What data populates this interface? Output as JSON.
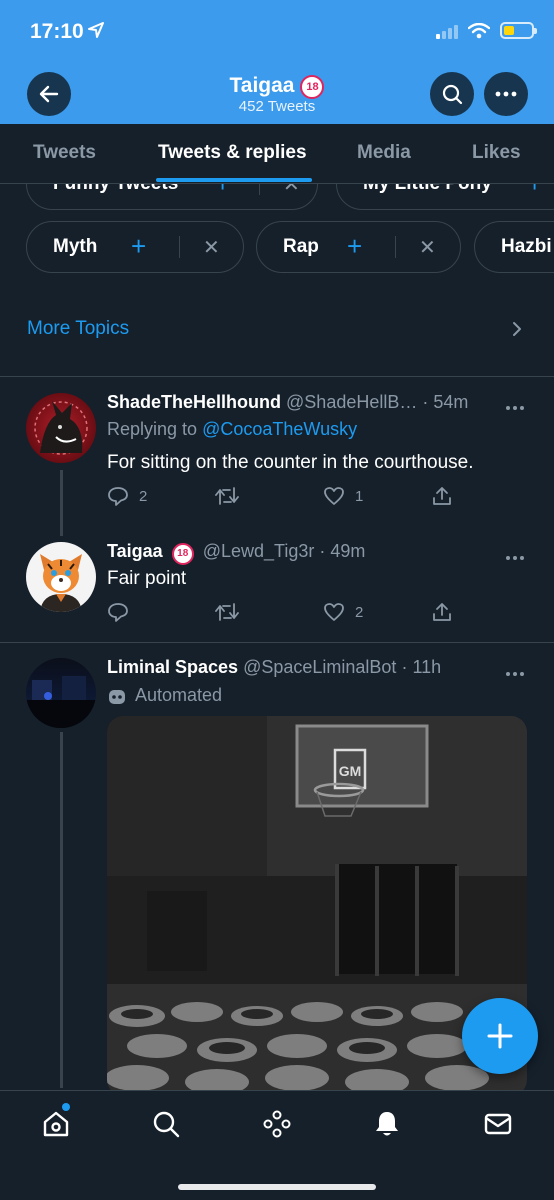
{
  "status_bar": {
    "time": "17:10",
    "battery_level": 0.4
  },
  "header": {
    "title": "Taigaa",
    "title_badge": "18",
    "subtitle": "452 Tweets"
  },
  "tabs": [
    {
      "label": "Tweets",
      "active": false
    },
    {
      "label": "Tweets & replies",
      "active": true
    },
    {
      "label": "Media",
      "active": false
    },
    {
      "label": "Likes",
      "active": false
    }
  ],
  "topics_row1": [
    {
      "label": "Funny Tweets"
    },
    {
      "label": "My Little Pony"
    }
  ],
  "topics_row2": [
    {
      "label": "Myth"
    },
    {
      "label": "Rap"
    },
    {
      "label": "Hazbi"
    }
  ],
  "more_topics": "More Topics",
  "tweets": [
    {
      "name": "ShadeTheHellhound",
      "handle": "@ShadeHellB…",
      "time": "· 54m",
      "replying_label": "Replying to",
      "replying_to": "@CocoaTheWusky",
      "text": "For sitting on the counter in the courthouse.",
      "replies": "2",
      "likes": "1"
    },
    {
      "name": "Taigaa",
      "badge": "18",
      "handle": "@Lewd_Tig3r",
      "time": "· 49m",
      "text": "Fair point",
      "replies": "",
      "likes": "2"
    },
    {
      "name": "Liminal Spaces",
      "handle": "@SpaceLiminalBot",
      "time": "· 11h",
      "automated": "Automated",
      "image_text": "GM"
    }
  ],
  "colors": {
    "header_bg": "#3c9bec",
    "bg": "#15202b",
    "accent": "#1d9bf0",
    "muted": "#8b98a5",
    "border": "#38444d"
  }
}
